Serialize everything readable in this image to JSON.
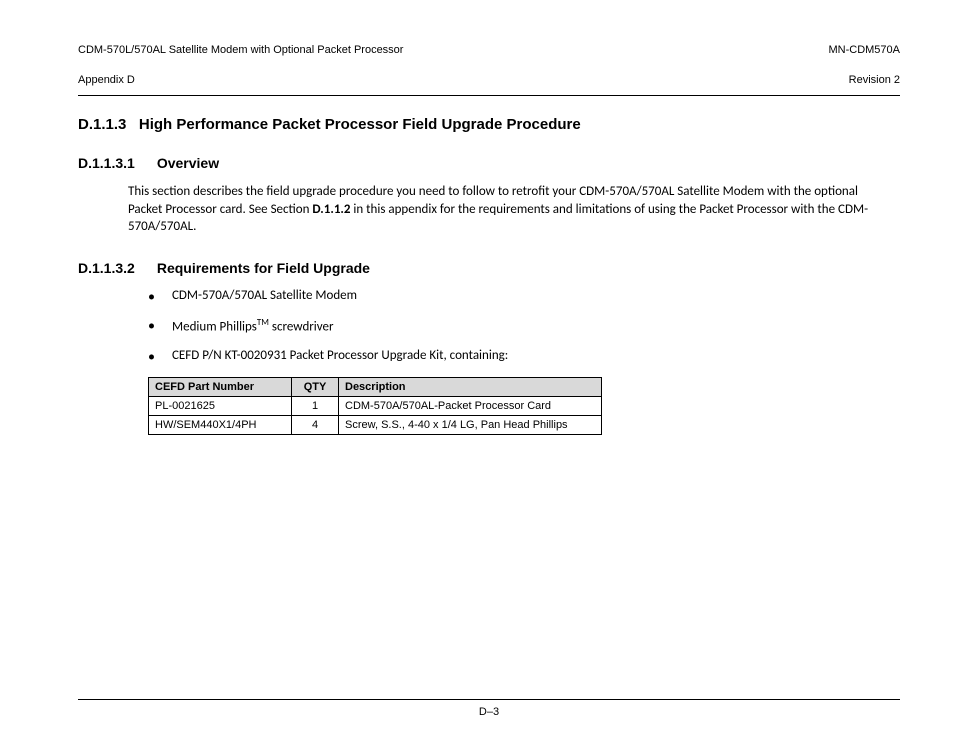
{
  "header": {
    "leftLine1": "CDM-570L/570AL Satellite Modem with Optional Packet Processor",
    "leftLine2": "Appendix D",
    "rightLine1": "MN-CDM570A",
    "rightLine2": "Revision 2"
  },
  "section_d113": {
    "number": "D.1.1.3",
    "title": "High Performance Packet Processor Field Upgrade Procedure"
  },
  "section_d1131": {
    "number": "D.1.1.3.1",
    "title": "Overview",
    "para_pre": "This section describes the field upgrade procedure you need to follow to retrofit your CDM-570A/570AL Satellite Modem with the optional Packet Processor card. See Section ",
    "para_bold": "D.1.1.2",
    "para_post": "  in this appendix for the requirements and limitations of using the Packet Processor with the CDM-570A/570AL."
  },
  "section_d1132": {
    "number": "D.1.1.3.2",
    "title": "Requirements for Field Upgrade",
    "bullets": {
      "b1": "CDM-570A/570AL Satellite Modem",
      "b2_pre": "Medium Phillips",
      "b2_tm": "TM",
      "b2_post": " screwdriver",
      "b3": "CEFD P/N KT-0020931 Packet Processor Upgrade Kit, containing:"
    }
  },
  "table": {
    "headers": {
      "part": "CEFD Part Number",
      "qty": "QTY",
      "desc": "Description"
    },
    "rows": [
      {
        "part": "PL-0021625",
        "qty": "1",
        "desc": "CDM-570A/570AL-Packet Processor Card"
      },
      {
        "part": "HW/SEM440X1/4PH",
        "qty": "4",
        "desc": "Screw, S.S., 4-40 x 1/4 LG, Pan Head Phillips"
      }
    ]
  },
  "footer": {
    "pageLabel": "D–3"
  }
}
